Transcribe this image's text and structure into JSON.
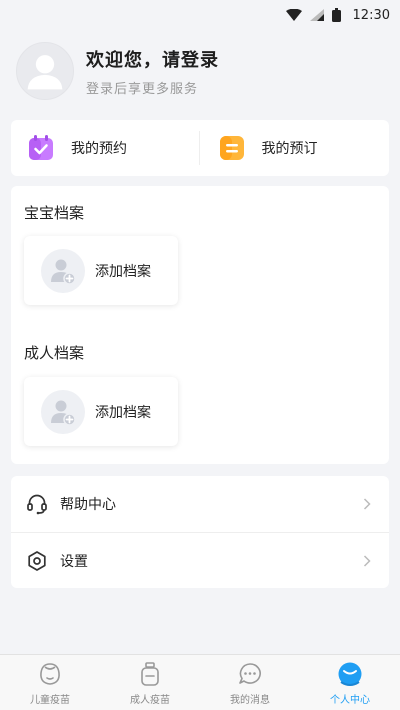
{
  "status_bar": {
    "time": "12:30"
  },
  "profile": {
    "title": "欢迎您，请登录",
    "subtitle": "登录后享更多服务",
    "avatar_icon": "default-user-icon"
  },
  "quick": {
    "appointment": {
      "label": "我的预约",
      "icon": "calendar-check-icon",
      "color": "#c87bff"
    },
    "order": {
      "label": "我的预订",
      "icon": "note-icon",
      "color": "#ffb63a"
    }
  },
  "archives": {
    "baby_title": "宝宝档案",
    "baby_add": "添加档案",
    "adult_title": "成人档案",
    "adult_add": "添加档案"
  },
  "menu": {
    "help": {
      "label": "帮助中心",
      "icon": "headset-icon"
    },
    "settings": {
      "label": "设置",
      "icon": "gear-icon"
    }
  },
  "tabs": [
    {
      "label": "儿童疫苗",
      "icon": "child-icon",
      "active": false
    },
    {
      "label": "成人疫苗",
      "icon": "vaccine-bottle-icon",
      "active": false
    },
    {
      "label": "我的消息",
      "icon": "chat-bubble-icon",
      "active": false
    },
    {
      "label": "个人中心",
      "icon": "person-center-icon",
      "active": true
    }
  ],
  "colors": {
    "accent": "#1f9ef3",
    "background": "#f3f4f7"
  }
}
